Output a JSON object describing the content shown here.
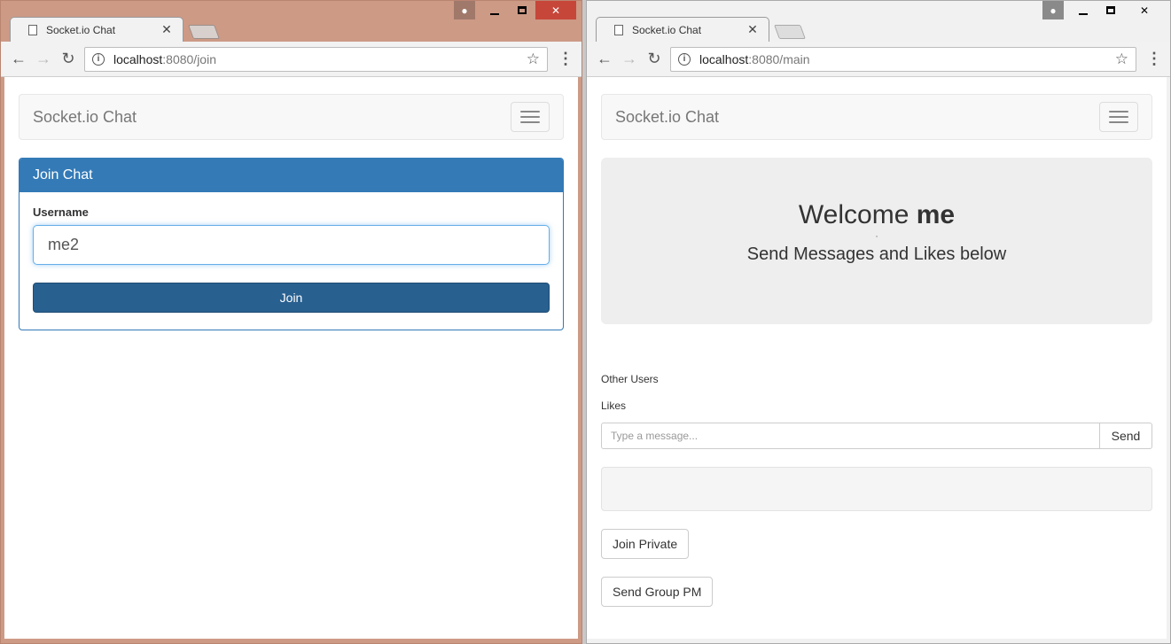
{
  "left_window": {
    "tab_title": "Socket.io Chat",
    "url_host": "localhost",
    "url_path": ":8080/join",
    "navbar_brand": "Socket.io Chat",
    "panel_title": "Join Chat",
    "username_label": "Username",
    "username_value": "me2",
    "join_button": "Join"
  },
  "right_window": {
    "tab_title": "Socket.io Chat",
    "url_host": "localhost",
    "url_path": ":8080/main",
    "navbar_brand": "Socket.io Chat",
    "welcome_prefix": "Welcome ",
    "welcome_user": "me",
    "separator": ",",
    "subtitle": "Send Messages and Likes below",
    "other_users_label": "Other Users",
    "likes_label": "Likes",
    "message_placeholder": "Type a message...",
    "send_button": "Send",
    "join_private_button": "Join Private",
    "send_group_pm_button": "Send Group PM"
  },
  "colors": {
    "primary": "#337ab7",
    "primary_dark": "#286090",
    "active_frame": "#cd9a86",
    "close_button": "#c7463a"
  }
}
